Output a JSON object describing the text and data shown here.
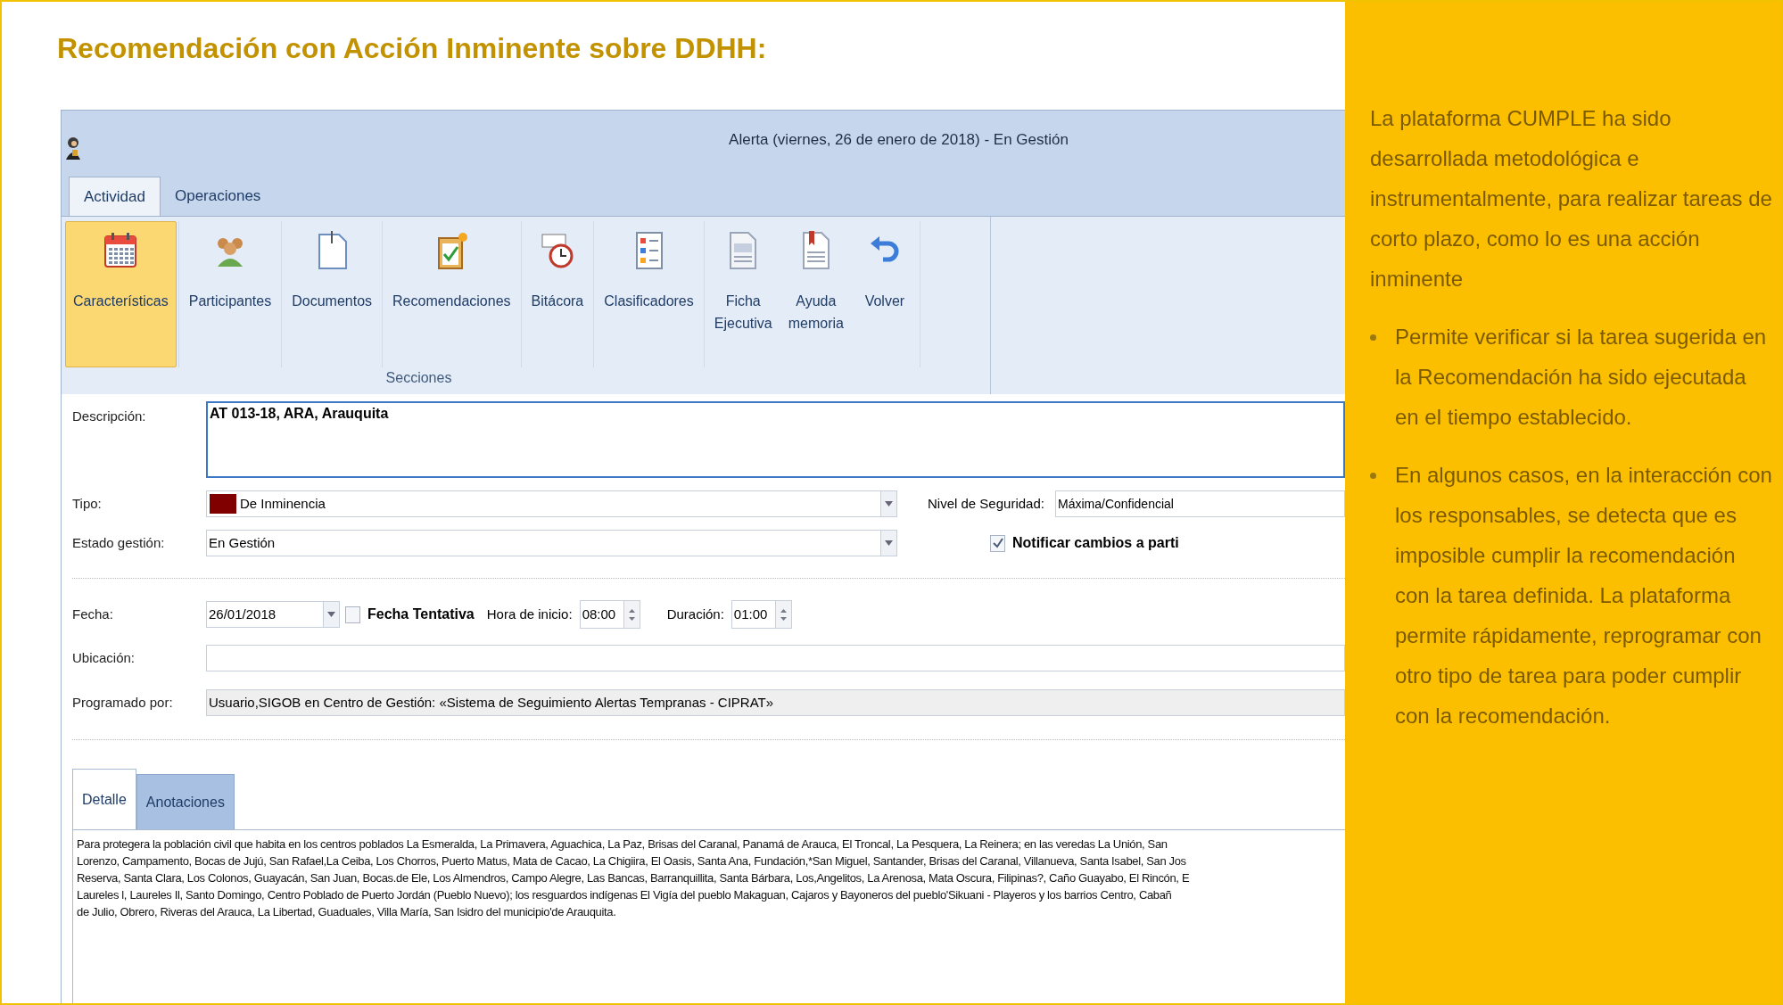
{
  "slide_title": "Recomendación con Acción Inminente sobre DDHH:",
  "window": {
    "title": "Alerta (viernes, 26 de enero de 2018) - En Gestión"
  },
  "tabs": [
    {
      "label": "Actividad",
      "selected": true
    },
    {
      "label": "Operaciones",
      "selected": false
    }
  ],
  "ribbon": {
    "buttons": [
      {
        "label": "Características",
        "kind": "calendar",
        "selected": true
      },
      {
        "label": "Participantes",
        "kind": "people",
        "selected": false
      },
      {
        "label": "Documentos",
        "kind": "document",
        "selected": false
      },
      {
        "label": "Recomendaciones",
        "kind": "clipboard",
        "selected": false
      },
      {
        "label": "Bitácora",
        "kind": "clock",
        "selected": false
      },
      {
        "label": "Clasificadores",
        "kind": "list",
        "selected": false
      },
      {
        "label": "Ficha Ejecutiva",
        "kind": "page",
        "selected": false
      },
      {
        "label": "Ayuda memoria",
        "kind": "bookmark",
        "selected": false
      },
      {
        "label": "Volver",
        "kind": "undo",
        "selected": false
      }
    ],
    "group_label": "Secciones"
  },
  "form": {
    "descripcion": {
      "label": "Descripción:",
      "value": "AT 013-18, ARA, Arauquita"
    },
    "tipo": {
      "label": "Tipo:",
      "value": "De Inminencia",
      "color": "#800000"
    },
    "nivel": {
      "label": "Nivel de Seguridad:",
      "value": "Máxima/Confidencial"
    },
    "estado": {
      "label": "Estado gestión:",
      "value": "En Gestión"
    },
    "notificar": {
      "label": "Notificar cambios a parti",
      "checked": true
    },
    "fecha": {
      "label": "Fecha:",
      "value": "26/01/2018"
    },
    "tentativa": {
      "label": "Fecha Tentativa",
      "checked": false
    },
    "hora": {
      "label": "Hora de inicio:",
      "value": "08:00"
    },
    "duracion": {
      "label": "Duración:",
      "value": "01:00"
    },
    "ubicacion": {
      "label": "Ubicación:"
    },
    "programado": {
      "label": "Programado por:",
      "value": "Usuario,SIGOB en Centro de Gestión: «Sistema de Seguimiento Alertas Tempranas - CIPRAT»"
    }
  },
  "detail_tabs": [
    {
      "label": "Detalle",
      "selected": true
    },
    {
      "label": "Anotaciones",
      "selected": false
    }
  ],
  "detail_lines": [
    "Para protegera la población civil que habita en los centros poblados La Esmeralda, La Primavera, Aguachica, La Paz, Brisas del Caranal, Panamá de Arauca, El Troncal, La Pesquera, La Reinera; en las veredas La Unión, San",
    "Lorenzo, Campamento, Bocas de Jujú, San Rafael,La Ceiba, Los Chorros, Puerto Matus, Mata de Cacao, La Chigiira, El Oasis, Santa Ana, Fundación,*San Miguel, Santander, Brisas del Caranal, Villanueva, Santa Isabel, San Jos",
    "Reserva, Santa Clara, Los Colonos, Guayacán, San Juan, Bocas.de Ele, Los Almendros, Campo Alegre, Las Bancas, Barranquillita, Santa Bárbara, Los,Angelitos, La Arenosa, Mata Oscura, Filipinas?, Caño Guayabo, El Rincón, E",
    "Laureles l, Laureles Il, Santo Domingo, Centro Poblado de Puerto Jordán (Pueblo Nuevo); los resguardos indígenas El Vigía del pueblo Makaguan, Cajaros y Bayoneros del pueblo'Sikuani - Playeros y los barrios Centro, Cabañ",
    "de Julio, Obrero, Riveras del Arauca, La Libertad, Guaduales, Villa María, San Isidro del municipio'de Arauquita."
  ],
  "panel": {
    "intro": "La plataforma CUMPLE ha sido desarrollada metodológica e instrumentalmente, para realizar tareas de corto plazo, como lo es una acción inminente",
    "bullets": [
      "Permite verificar si la tarea sugerida en la Recomendación ha sido ejecutada en el tiempo establecido.",
      "En algunos casos, en la interacción con los responsables, se detecta que es imposible cumplir la recomendación con la tarea definida. La plataforma permite rápidamente, reprogramar con otro tipo de tarea para poder cumplir con la recomendación."
    ]
  }
}
